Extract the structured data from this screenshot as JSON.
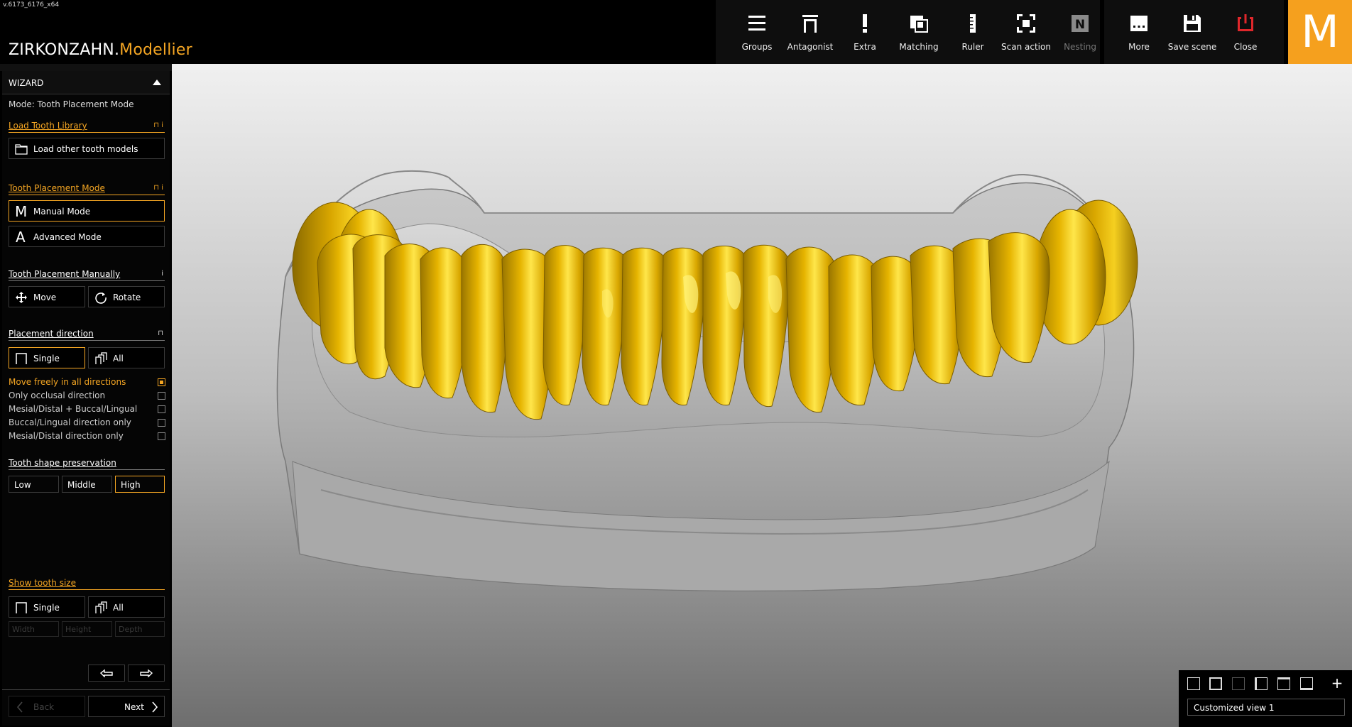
{
  "app": {
    "version": "v.6173_6176_x64",
    "brand_main": "ZIRKONZAHN.",
    "brand_accent": "Modellier",
    "logo_letter": "M",
    "accent_color": "#f5a623"
  },
  "toolbar": {
    "tools": [
      {
        "label": "Groups",
        "icon": "hamburger-icon"
      },
      {
        "label": "Antagonist",
        "icon": "antagonist-icon"
      },
      {
        "label": "Extra",
        "icon": "exclamation-icon"
      },
      {
        "label": "Matching",
        "icon": "matching-icon"
      },
      {
        "label": "Ruler",
        "icon": "ruler-icon"
      },
      {
        "label": "Scan action",
        "icon": "scan-action-icon"
      },
      {
        "label": "Nesting",
        "icon": "nesting-icon",
        "disabled": true
      }
    ],
    "right_tools": [
      {
        "label": "More",
        "icon": "more-icon"
      },
      {
        "label": "Save scene",
        "icon": "floppy-icon"
      },
      {
        "label": "Close",
        "icon": "power-icon"
      }
    ],
    "nesting_letter": "N"
  },
  "wizard": {
    "title": "WIZARD",
    "mode_text": "Mode: Tooth Placement Mode",
    "load_library": {
      "title": "Load Tooth Library",
      "button": "Load other tooth models"
    },
    "placement_mode": {
      "title": "Tooth Placement Mode",
      "manual": "Manual Mode",
      "advanced": "Advanced Mode",
      "manual_letter": "M",
      "advanced_letter": "A"
    },
    "manually": {
      "title": "Tooth Placement Manually",
      "move": "Move",
      "rotate": "Rotate"
    },
    "direction": {
      "title": "Placement direction",
      "single": "Single",
      "all": "All",
      "options": [
        {
          "label": "Move freely in all directions",
          "checked": true
        },
        {
          "label": "Only occlusal direction",
          "checked": false
        },
        {
          "label": "Mesial/Distal + Buccal/Lingual",
          "checked": false
        },
        {
          "label": "Buccal/Lingual direction only",
          "checked": false
        },
        {
          "label": "Mesial/Distal direction only",
          "checked": false
        }
      ]
    },
    "shape": {
      "title": "Tooth shape preservation",
      "low": "Low",
      "middle": "Middle",
      "high": "High",
      "selected": "High"
    },
    "size": {
      "title": "Show tooth size",
      "single": "Single",
      "all": "All",
      "width": "Width",
      "height": "Height",
      "depth": "Depth"
    },
    "back": "Back",
    "next": "Next"
  },
  "view_panel": {
    "view_name": "Customized view 1"
  }
}
